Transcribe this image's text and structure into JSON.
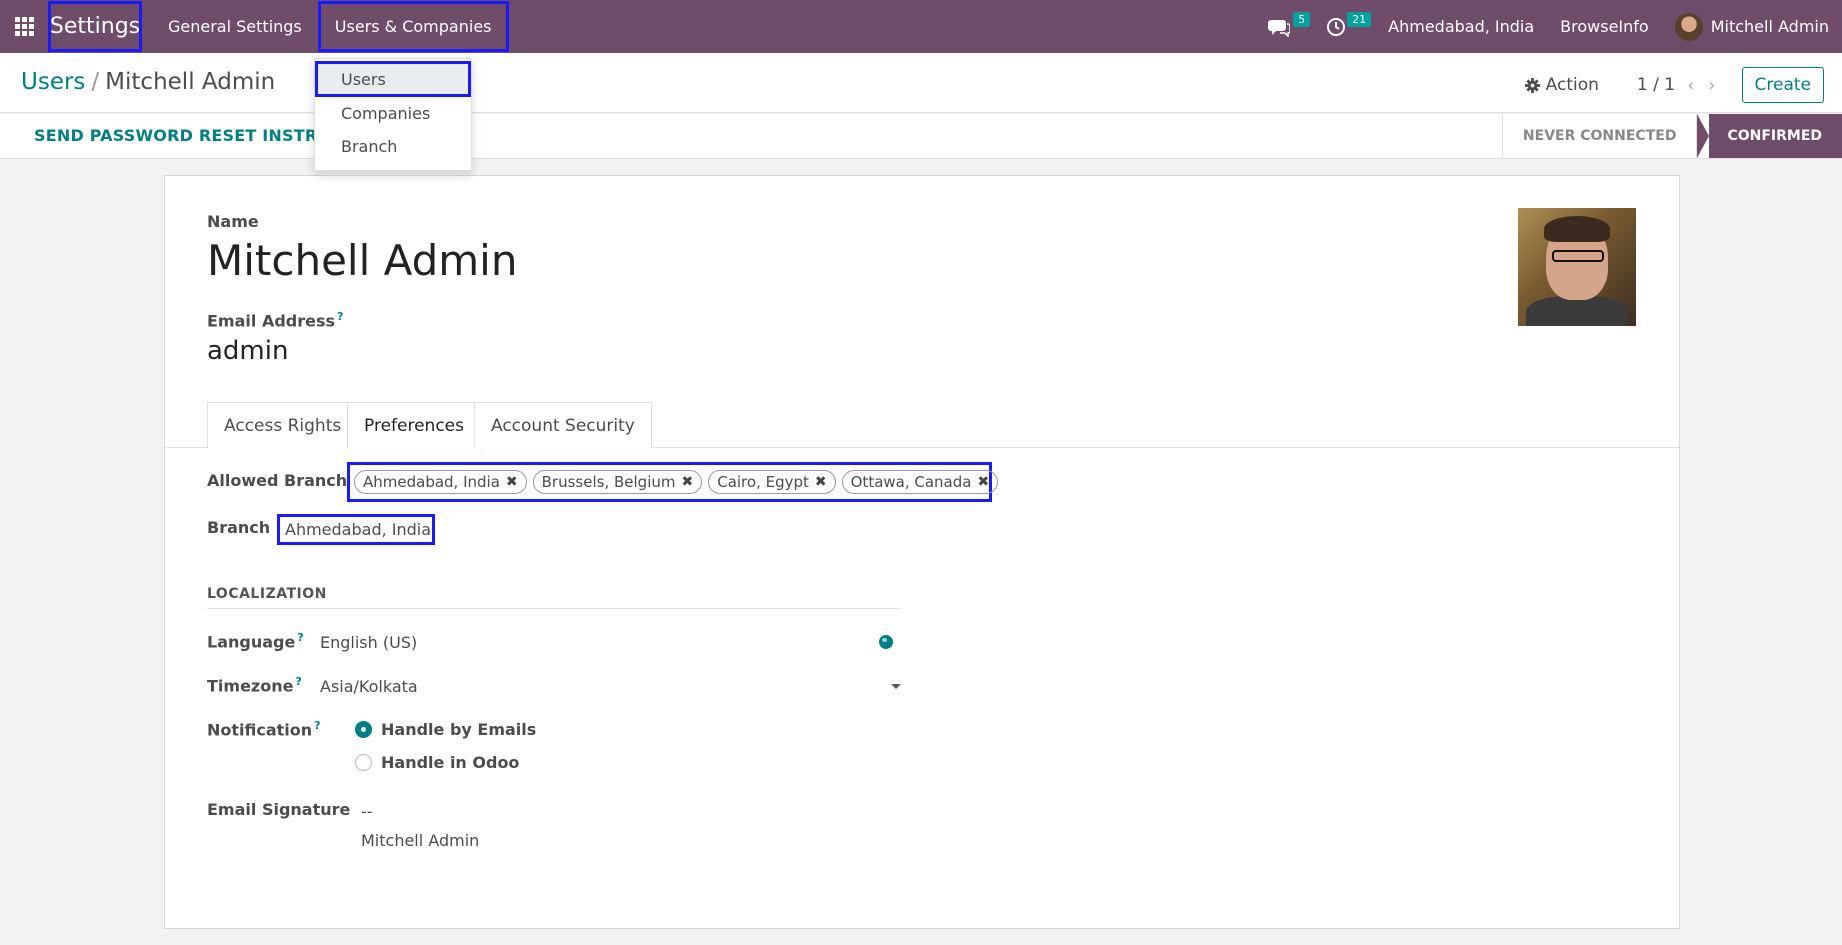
{
  "navbar": {
    "app_name": "Settings",
    "menus": [
      "General Settings",
      "Users & Companies"
    ],
    "messages_count": "5",
    "activities_count": "21",
    "current_branch": "Ahmedabad, India",
    "company": "BrowseInfo",
    "user": "Mitchell Admin"
  },
  "dropdown": {
    "items": [
      "Users",
      "Companies",
      "Branch"
    ]
  },
  "control_panel": {
    "breadcrumb_parent": "Users",
    "breadcrumb_sep": "/",
    "breadcrumb_current": "Mitchell Admin",
    "action_label": "Action",
    "pager": "1 / 1",
    "create_label": "Create"
  },
  "statusbar": {
    "reset_button": "SEND PASSWORD RESET INSTRUCTIONS",
    "stages": [
      "NEVER CONNECTED",
      "CONFIRMED"
    ],
    "active_stage": "CONFIRMED"
  },
  "form": {
    "name_label": "Name",
    "name_value": "Mitchell Admin",
    "email_label": "Email Address",
    "email_value": "admin",
    "help_mark": "?",
    "tabs": [
      "Access Rights",
      "Preferences",
      "Account Security"
    ],
    "active_tab": "Preferences",
    "allowed_branch_label": "Allowed Branch",
    "allowed_branches": [
      "Ahmedabad, India",
      "Brussels, Belgium",
      "Cairo, Egypt",
      "Ottawa, Canada"
    ],
    "branch_label": "Branch",
    "branch_value": "Ahmedabad, India",
    "localization_title": "LOCALIZATION",
    "language_label": "Language",
    "language_value": "English (US)",
    "timezone_label": "Timezone",
    "timezone_value": "Asia/Kolkata",
    "notification_label": "Notification",
    "notification_options": [
      "Handle by Emails",
      "Handle in Odoo"
    ],
    "notification_selected": "Handle by Emails",
    "signature_label": "Email Signature",
    "signature_dash": "--",
    "signature_name": "Mitchell Admin"
  },
  "colors": {
    "navbar": "#6f4c6a",
    "accent": "#017e84",
    "highlight_box": "#1a1aff"
  }
}
